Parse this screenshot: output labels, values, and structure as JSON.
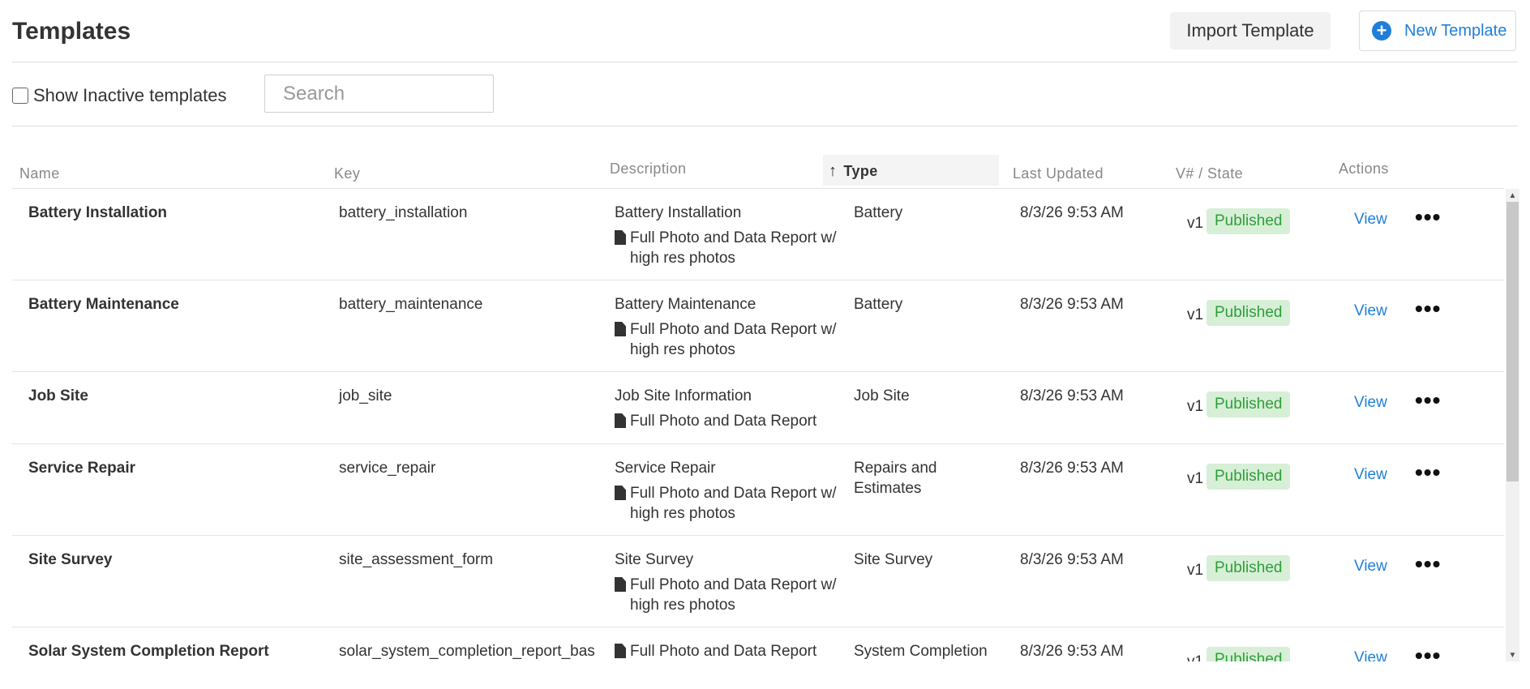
{
  "header": {
    "title": "Templates",
    "import_label": "Import Template",
    "new_label": "New Template"
  },
  "filters": {
    "show_inactive_label": "Show Inactive templates",
    "search_placeholder": "Search"
  },
  "columns": {
    "name": "Name",
    "key": "Key",
    "description": "Description",
    "type": "Type",
    "last_updated": "Last Updated",
    "version_state": "V# / State",
    "actions": "Actions"
  },
  "rows": [
    {
      "name": "Battery Installation",
      "key": "battery_installation",
      "desc_title": "Battery Installation",
      "report": "Full Photo and Data Report w/ high res photos",
      "type": "Battery",
      "updated": "8/3/26 9:53 AM",
      "version": "v1",
      "state": "Published",
      "view": "View",
      "more": "•••"
    },
    {
      "name": "Battery Maintenance",
      "key": "battery_maintenance",
      "desc_title": "Battery Maintenance",
      "report": "Full Photo and Data Report w/ high res photos",
      "type": "Battery",
      "updated": "8/3/26 9:53 AM",
      "version": "v1",
      "state": "Published",
      "view": "View",
      "more": "•••"
    },
    {
      "name": "Job Site",
      "key": "job_site",
      "desc_title": "Job Site Information",
      "report": "Full Photo and Data Report",
      "type": "Job Site",
      "updated": "8/3/26 9:53 AM",
      "version": "v1",
      "state": "Published",
      "view": "View",
      "more": "•••"
    },
    {
      "name": "Service Repair",
      "key": "service_repair",
      "desc_title": "Service Repair",
      "report": "Full Photo and Data Report w/ high res photos",
      "type": "Repairs and Estimates",
      "updated": "8/3/26 9:53 AM",
      "version": "v1",
      "state": "Published",
      "view": "View",
      "more": "•••"
    },
    {
      "name": "Site Survey",
      "key": "site_assessment_form",
      "desc_title": "Site Survey",
      "report": "Full Photo and Data Report w/ high res photos",
      "type": "Site Survey",
      "updated": "8/3/26 9:53 AM",
      "version": "v1",
      "state": "Published",
      "view": "View",
      "more": "•••"
    },
    {
      "name": "Solar System Completion Report",
      "key": "solar_system_completion_report_bas",
      "desc_title": "",
      "report": "Full Photo and Data Report",
      "type": "System Completion",
      "updated": "8/3/26 9:53 AM",
      "version": "v1",
      "state": "Published",
      "view": "View",
      "more": "•••"
    }
  ],
  "scrollbar": {
    "up_icon": "▲",
    "down_icon": "▼"
  },
  "icons": {
    "plus": "+",
    "sort_arrow": "↑"
  },
  "colors": {
    "accent": "#1e7fd8",
    "published_bg": "#d6efd6",
    "published_text": "#2f9e3a"
  }
}
